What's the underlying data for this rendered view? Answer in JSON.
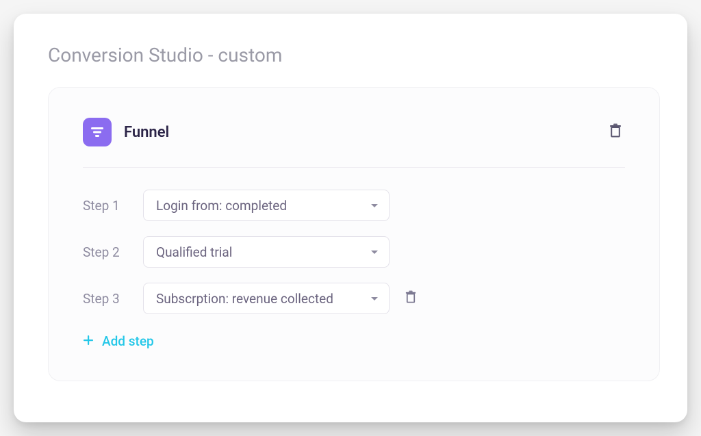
{
  "page": {
    "title": "Conversion Studio - custom"
  },
  "card": {
    "title": "Funnel",
    "icon_name": "funnel-icon"
  },
  "steps": [
    {
      "label": "Step 1",
      "value": "Login from: completed",
      "deletable": false
    },
    {
      "label": "Step 2",
      "value": "Qualified trial",
      "deletable": false
    },
    {
      "label": "Step 3",
      "value": "Subscrption: revenue collected",
      "deletable": true
    }
  ],
  "actions": {
    "add_step": "Add step"
  },
  "colors": {
    "accent": "#8b6cf0",
    "link": "#23c7e8",
    "muted": "#8e8ba0",
    "heading": "#2c2548"
  }
}
